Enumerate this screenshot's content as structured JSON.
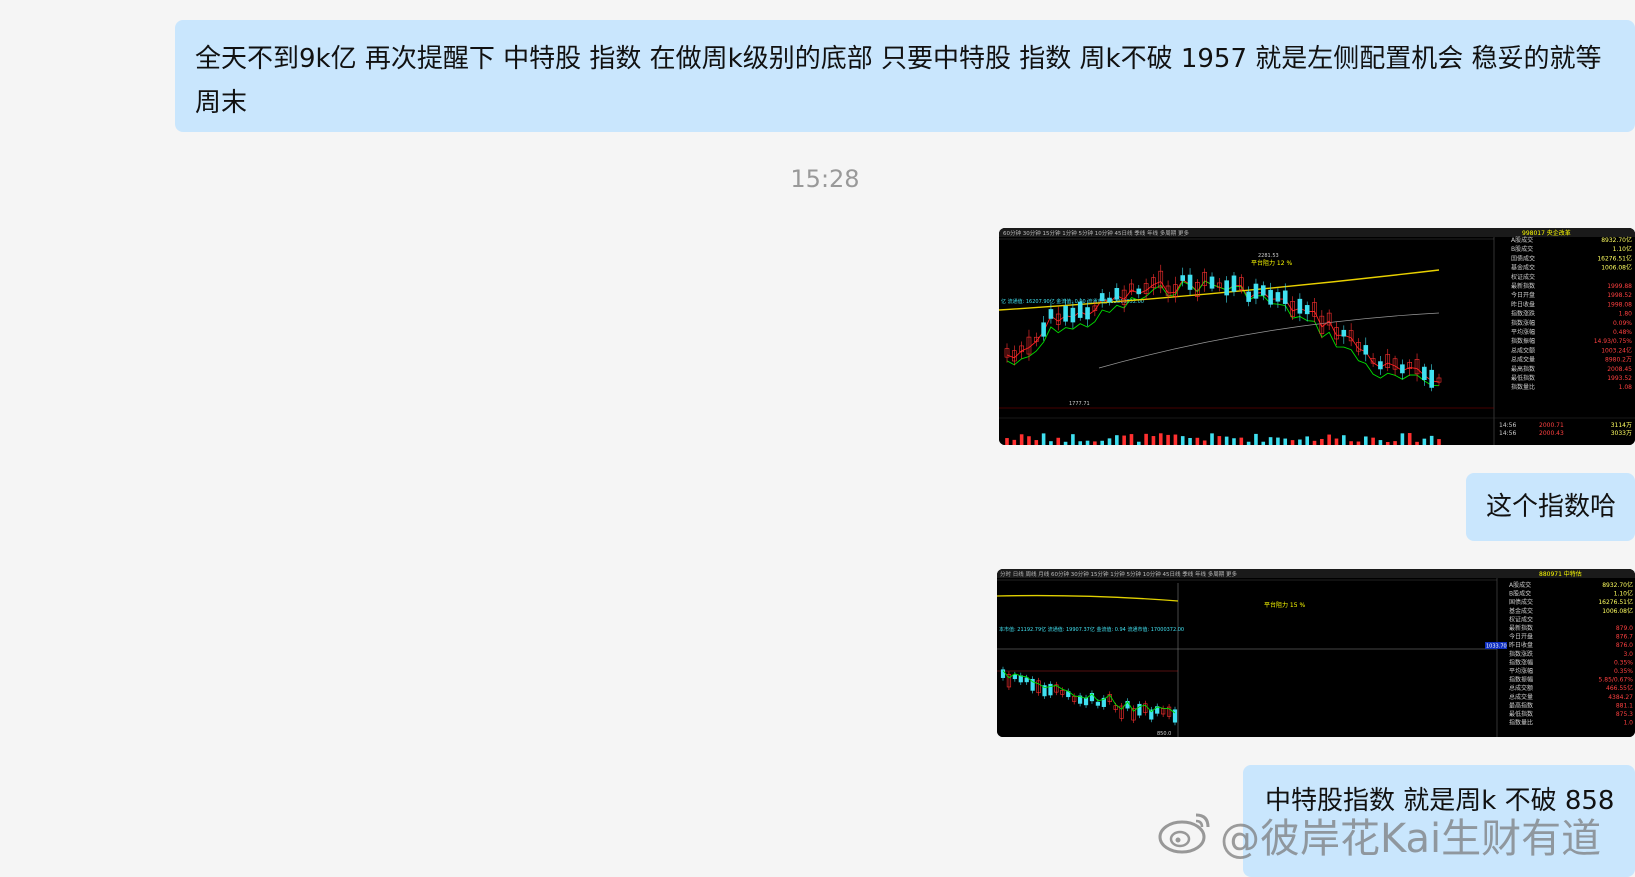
{
  "chat": {
    "messages": [
      {
        "text": "全天不到9k亿 再次提醒下 中特股 指数  在做周k级别的底部  只要中特股 指数 周k不破 1957 就是左侧配置机会 稳妥的就等周末"
      },
      {
        "text": "这个指数哈"
      },
      {
        "text": "中特股指数 就是周k 不破 858"
      }
    ],
    "timestamp": "15:28"
  },
  "shot1": {
    "toolbar": "60分钟  30分钟  15分钟  1分钟  5分钟  10分钟  45日线  季线  年线  多周期  更多",
    "index_name": "998017 央企改革",
    "panel": [
      {
        "label": "A股成交",
        "value": "8932.70亿"
      },
      {
        "label": "B股成交",
        "value": "1.10亿"
      },
      {
        "label": "国债成交",
        "value": "16276.51亿"
      },
      {
        "label": "基金成交",
        "value": "1006.08亿"
      },
      {
        "label": "权证成交",
        "value": ""
      },
      {
        "label": "最新指数",
        "value": "1999.88"
      },
      {
        "label": "今日开盘",
        "value": "1998.52"
      },
      {
        "label": "昨日收盘",
        "value": "1998.08"
      },
      {
        "label": "指数涨跌",
        "value": "1.80"
      },
      {
        "label": "指数涨幅",
        "value": "0.09%"
      },
      {
        "label": "平均涨幅",
        "value": "0.48%"
      },
      {
        "label": "指数振幅",
        "value": "14.93/0.75%"
      },
      {
        "label": "总成交额",
        "value": "1003.24亿"
      },
      {
        "label": "总成交量",
        "value": "8980.2万"
      },
      {
        "label": "最高指数",
        "value": "2008.45"
      },
      {
        "label": "最低指数",
        "value": "1993.52"
      },
      {
        "label": "指数量比",
        "value": "1.08"
      }
    ],
    "ticks": [
      {
        "time": "14:56",
        "price": "2000.71",
        "vol": "3114万"
      },
      {
        "time": "14:56",
        "price": "2000.43",
        "vol": "3033万"
      }
    ],
    "high_label": "2281.53",
    "low_label": "1777.71",
    "info_line": "亿 流通值: 16207.90亿 金流值: 0.90 流通市值: 32813852.00",
    "annotation": "平台阻力 12 %",
    "colors": {
      "up": "#ff3030",
      "down": "#40e0f0",
      "ma5": "#ffffff",
      "ma10": "#ffff00",
      "ma20": "#ff40ff",
      "ma60": "#00ff00"
    }
  },
  "shot2": {
    "toolbar": "分时  日线  周线  月线  60分钟  30分钟  15分钟  1分钟  5分钟  10分钟  45日线  季线  年线  多周期  更多",
    "index_name": "880971 中特估",
    "panel": [
      {
        "label": "A股成交",
        "value": "8932.70亿"
      },
      {
        "label": "B股成交",
        "value": "1.10亿"
      },
      {
        "label": "国债成交",
        "value": "16276.51亿"
      },
      {
        "label": "基金成交",
        "value": "1006.08亿"
      },
      {
        "label": "权证成交",
        "value": ""
      },
      {
        "label": "最新指数",
        "value": "879.0"
      },
      {
        "label": "今日开盘",
        "value": "876.7"
      },
      {
        "label": "昨日收盘",
        "value": "876.0"
      },
      {
        "label": "指数涨跌",
        "value": "3.0"
      },
      {
        "label": "指数涨幅",
        "value": "0.35%"
      },
      {
        "label": "平均涨幅",
        "value": "0.35%"
      },
      {
        "label": "指数振幅",
        "value": "5.85/0.67%"
      },
      {
        "label": "总成交额",
        "value": "466.55亿"
      },
      {
        "label": "总成交量",
        "value": "4384.27"
      },
      {
        "label": "最高指数",
        "value": "881.1"
      },
      {
        "label": "最低指数",
        "value": "875.3"
      },
      {
        "label": "指数量比",
        "value": "1.0"
      }
    ],
    "low_label": "850.0",
    "info_line": "本市值: 21192.79亿 流通值: 19907.37亿 金流值: 0.94 流通市值: 17000372.00",
    "annotation": "平台阻力 15 %",
    "price_marker": "1033.70"
  },
  "watermark": {
    "text": "@彼岸花Kai生财有道",
    "icon": "weibo-logo-icon"
  }
}
